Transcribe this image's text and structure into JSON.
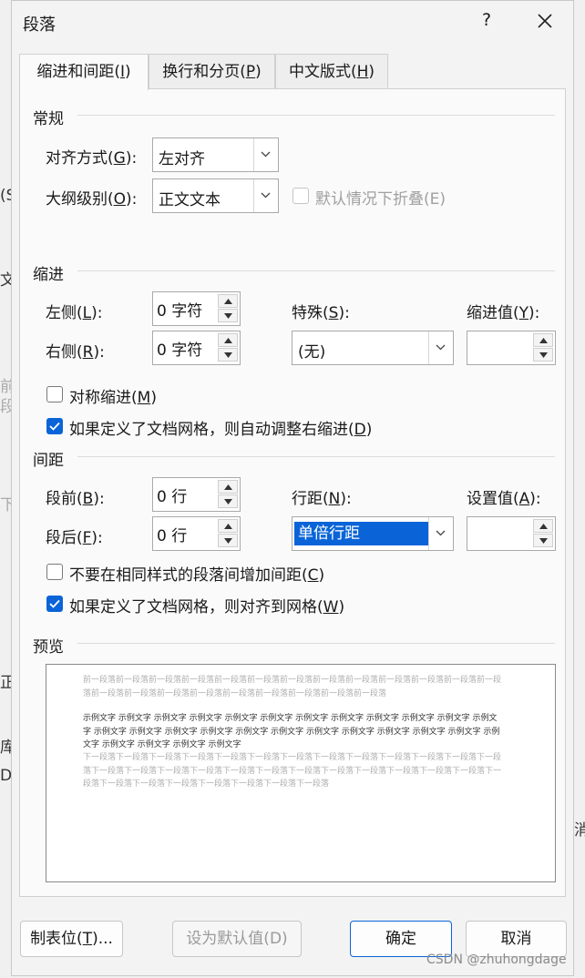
{
  "title": "段落",
  "help_label": "?",
  "close_label": "✕",
  "tabs": [
    {
      "label": "缩进和间距(",
      "key": "I",
      "end": ")"
    },
    {
      "label": "换行和分页(",
      "key": "P",
      "end": ")"
    },
    {
      "label": "中文版式(",
      "key": "H",
      "end": ")"
    }
  ],
  "general": {
    "heading": "常规",
    "alignment_label": "对齐方式(",
    "alignment_key": "G",
    "alignment_end": "):",
    "alignment_value": "左对齐",
    "outline_label": "大纲级别(",
    "outline_key": "O",
    "outline_end": "):",
    "outline_value": "正文文本",
    "collapse_label": "默认情况下折叠(E)"
  },
  "indent": {
    "heading": "缩进",
    "left_label": "左侧(",
    "left_key": "L",
    "left_end": "):",
    "left_value": "0 字符",
    "right_label": "右侧(",
    "right_key": "R",
    "right_end": "):",
    "right_value": "0 字符",
    "special_label": "特殊(",
    "special_key": "S",
    "special_end": "):",
    "special_value": "(无)",
    "by_label": "缩进值(",
    "by_key": "Y",
    "by_end": "):",
    "by_value": "",
    "mirror_label": "对称缩进(",
    "mirror_key": "M",
    "mirror_end": ")",
    "mirror_checked": false,
    "auto_adjust_label": "如果定义了文档网格，则自动调整右缩进(",
    "auto_adjust_key": "D",
    "auto_adjust_end": ")",
    "auto_adjust_checked": true
  },
  "spacing": {
    "heading": "间距",
    "before_label": "段前(",
    "before_key": "B",
    "before_end": "):",
    "before_value": "0 行",
    "after_label": "段后(",
    "after_key": "F",
    "after_end": "):",
    "after_value": "0 行",
    "line_label": "行距(",
    "line_key": "N",
    "line_end": "):",
    "line_value": "单倍行距",
    "at_label": "设置值(",
    "at_key": "A",
    "at_end": "):",
    "at_value": "",
    "no_space_label": "不要在相同样式的段落间增加间距(",
    "no_space_key": "C",
    "no_space_end": ")",
    "no_space_checked": false,
    "snap_label": "如果定义了文档网格，则对齐到网格(",
    "snap_key": "W",
    "snap_end": ")",
    "snap_checked": true
  },
  "preview": {
    "heading": "预览",
    "prev_text": "前一段落前一段落前一段落前一段落前一段落前一段落前一段落前一段落前一段落前一段落前一段落前一段落前一段落前一段落前一段落前一段落前一段落前一段落前一段落前一段落前一段落前一段落",
    "sample_text": "示例文字 示例文字 示例文字 示例文字 示例文字 示例文字 示例文字 示例文字 示例文字 示例文字 示例文字 示例文字 示例文字 示例文字 示例文字 示例文字 示例文字 示例文字 示例文字 示例文字 示例文字 示例文字 示例文字 示例文字 示例文字 示例文字 示例文字 示例文字",
    "next_text": "下一段落下一段落下一段落下一段落下一段落下一段落下一段落下一段落下一段落下一段落下一段落下一段落下一段落下一段落下一段落下一段落下一段落下一段落下一段落下一段落下一段落下一段落下一段落下一段落下一段落下一段落下一段落下一段落下一段落下一段落下一段落下一段落下一段落"
  },
  "footer": {
    "tabs_label": "制表位(",
    "tabs_key": "T",
    "tabs_end": ")...",
    "default_label": "设为默认值(D)",
    "ok_label": "确定",
    "cancel_label": "取消"
  },
  "background": {
    "frag1": "(S",
    "frag2": "文",
    "frag3": "前",
    "frag4": "段",
    "frag5": "下",
    "frag6": "库",
    "frag7": "D",
    "frag8": "消",
    "frag9": "正"
  },
  "watermark": "CSDN @zhuhongdage",
  "colors": {
    "accent": "#0a64d8"
  }
}
